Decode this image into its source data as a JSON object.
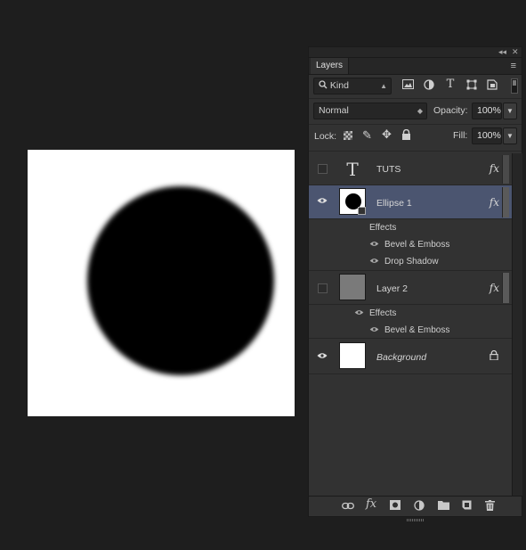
{
  "panel": {
    "strip_collapse": "◂◂",
    "strip_close": "✕",
    "tab_label": "Layers",
    "menu_icon": "≡",
    "filter": {
      "label": "Kind",
      "icon": "search-icon"
    },
    "blend_mode": "Normal",
    "opacity_label": "Opacity:",
    "opacity_value": "100%",
    "lock_label": "Lock:",
    "fill_label": "Fill:",
    "fill_value": "100%"
  },
  "layers": [
    {
      "name": "TUTS",
      "type": "text",
      "visible": false,
      "has_fx": true,
      "fx_label": "fx"
    },
    {
      "name": "Ellipse 1",
      "type": "shape",
      "visible": true,
      "selected": true,
      "has_fx": true,
      "fx_label": "fx",
      "effects_label": "Effects",
      "effects": [
        "Bevel & Emboss",
        "Drop Shadow"
      ]
    },
    {
      "name": "Layer 2",
      "type": "fill",
      "visible": false,
      "has_fx": true,
      "fx_label": "fx",
      "effects_label": "Effects",
      "effects": [
        "Bevel & Emboss"
      ]
    },
    {
      "name": "Background",
      "type": "background",
      "visible": true,
      "locked": true
    }
  ],
  "colors": {
    "selected_row": "#4b5570",
    "app_bg": "#1e1e1e",
    "panel_bg": "#323232"
  }
}
